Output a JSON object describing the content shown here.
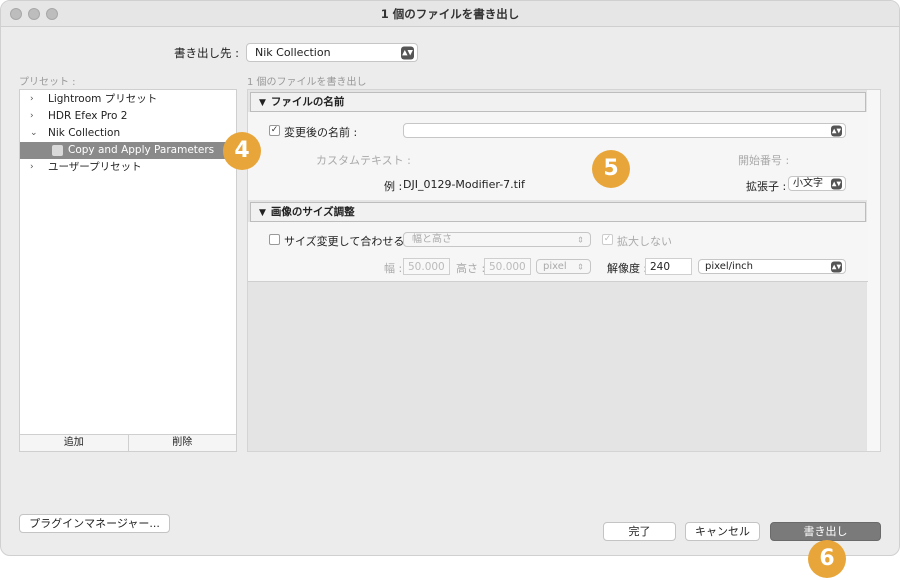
{
  "window": {
    "title": "1 個のファイルを書き出し"
  },
  "destination": {
    "label": "書き出し先 :",
    "value": "Nik Collection"
  },
  "presets": {
    "label": "プリセット :",
    "items": [
      {
        "label": "Lightroom プリセット",
        "chevron": "›"
      },
      {
        "label": "HDR Efex Pro 2",
        "chevron": "›"
      },
      {
        "label": "Nik Collection",
        "chevron": "⌄"
      },
      {
        "label": "Copy and Apply Parameters"
      },
      {
        "label": "ユーザープリセット",
        "chevron": "›"
      }
    ],
    "add_label": "追加",
    "remove_label": "削除"
  },
  "export_count": "1 個のファイルを書き出し",
  "file_naming": {
    "title": "ファイルの名前",
    "rename_label": "変更後の名前 :",
    "custom_text_label": "カスタムテキスト :",
    "start_number_label": "開始番号 :",
    "example_label": "例 :",
    "example_value": "DJI_0129-Modifier-7.tif",
    "extension_label": "拡張子 :",
    "extension_value": "小文字"
  },
  "image_sizing": {
    "title": "画像のサイズ調整",
    "resize_label": "サイズ変更して合わせる :",
    "resize_mode": "幅と高さ",
    "dont_enlarge_label": "拡大しない",
    "width_label": "幅 :",
    "width_value": "50.000",
    "height_label": "高さ :",
    "height_value": "50.000",
    "unit_value": "pixel",
    "resolution_label": "解像度 :",
    "resolution_value": "240",
    "resolution_unit": "pixel/inch"
  },
  "badges": [
    "4",
    "5",
    "6"
  ],
  "footer": {
    "plugin_manager": "プラグインマネージャー...",
    "done": "完了",
    "cancel": "キャンセル",
    "export": "書き出し"
  }
}
